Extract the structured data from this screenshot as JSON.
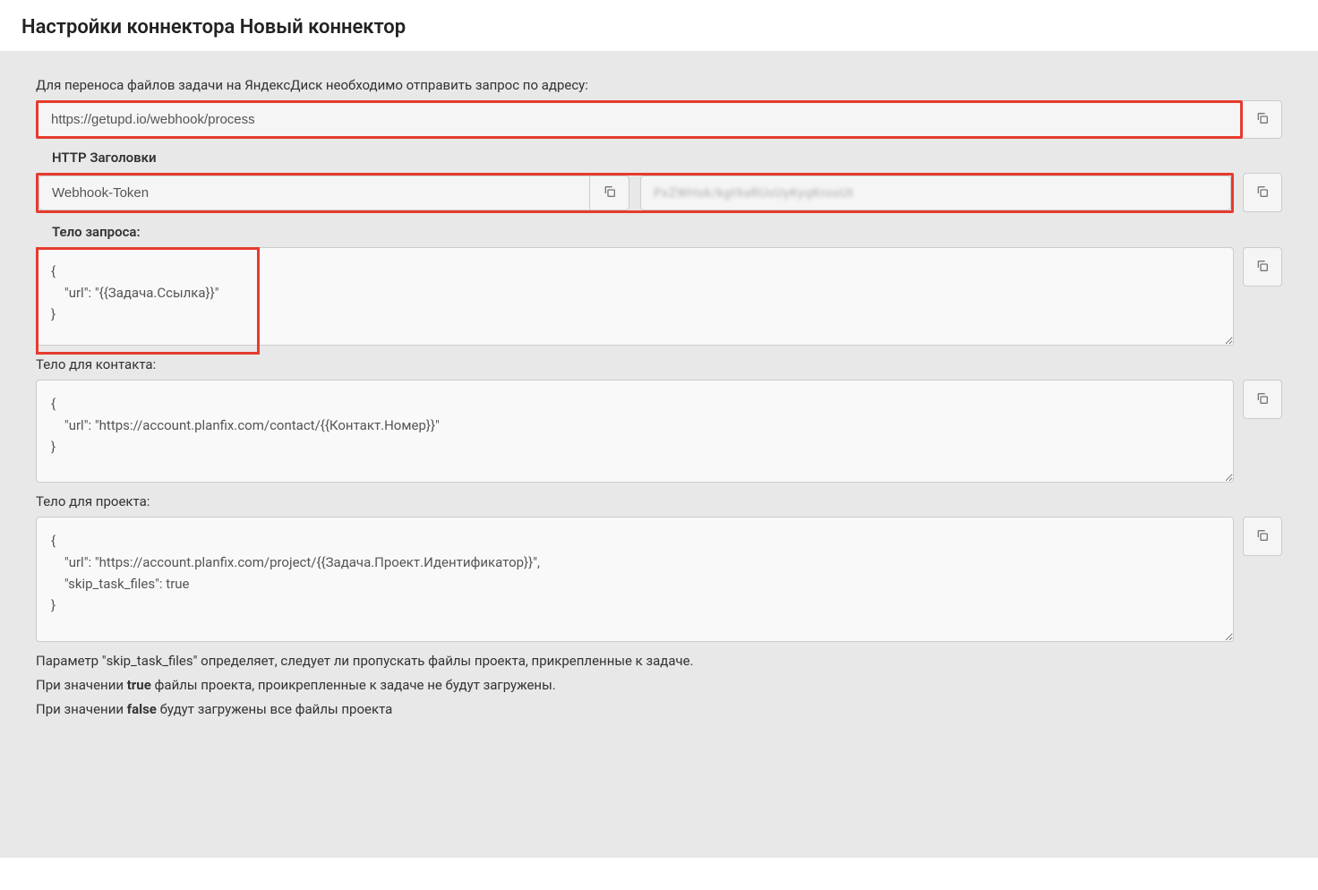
{
  "pageTitle": "Настройки коннектора Новый коннектор",
  "introText": "Для переноса файлов задачи на ЯндексДиск необходимо отправить запрос по адресу:",
  "webhookUrl": "https://getupd.io/webhook/process",
  "headersLabel": "HTTP Заголовки",
  "headerName": "Webhook-Token",
  "headerValueObscured": "PxZWHsk/kgt9aRUsUyKyqKrooUt",
  "bodyLabel": "Тело запроса:",
  "bodyContent": "{\n    \"url\": \"{{Задача.Ссылка}}\"\n}",
  "contactBodyLabel": "Тело для контакта:",
  "contactBodyContent": "{\n    \"url\": \"https://account.planfix.com/contact/{{Контакт.Номер}}\"\n}",
  "projectBodyLabel": "Тело для проекта:",
  "projectBodyContent": "{\n    \"url\": \"https://account.planfix.com/project/{{Задача.Проект.Идентификатор}}\",\n    \"skip_task_files\": true\n}",
  "notes": {
    "line1a": "Параметр \"skip_task_files\" определяет, следует ли пропускать файлы проекта, прикрепленные к задаче.",
    "line2a": "При значении ",
    "line2b": "true",
    "line2c": " файлы проекта, проикрепленные к задаче не будут загружены.",
    "line3a": "При значении ",
    "line3b": "false",
    "line3c": " будут загружены все файлы проекта"
  }
}
